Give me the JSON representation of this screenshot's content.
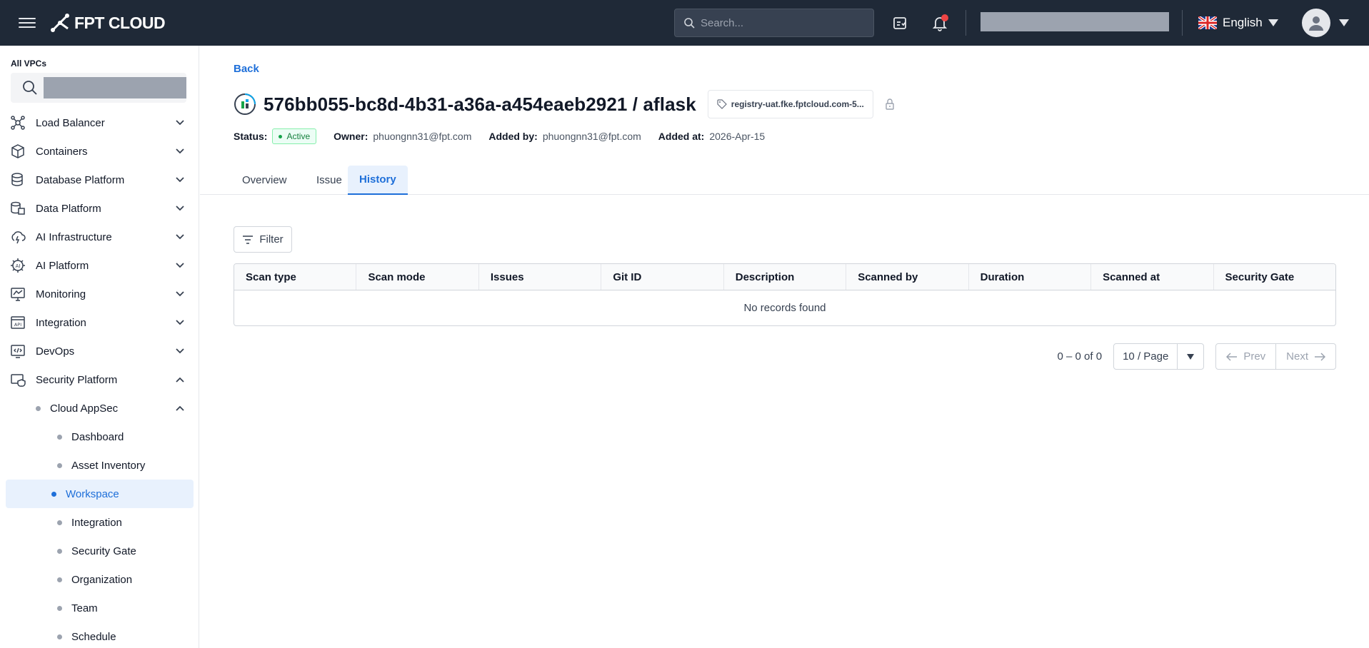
{
  "topbar": {
    "brand": "FPT CLOUD",
    "search_placeholder": "Search...",
    "language": "English"
  },
  "sidebar": {
    "vpc_label": "All VPCs",
    "items": [
      {
        "label": "Load Balancer",
        "icon": "load-balancer-icon",
        "expanded": false
      },
      {
        "label": "Containers",
        "icon": "containers-icon",
        "expanded": false
      },
      {
        "label": "Database Platform",
        "icon": "database-icon",
        "expanded": false
      },
      {
        "label": "Data Platform",
        "icon": "data-platform-icon",
        "expanded": false
      },
      {
        "label": "AI Infrastructure",
        "icon": "ai-infrastructure-icon",
        "expanded": false
      },
      {
        "label": "AI Platform",
        "icon": "ai-platform-icon",
        "expanded": false
      },
      {
        "label": "Monitoring",
        "icon": "monitoring-icon",
        "expanded": false
      },
      {
        "label": "Integration",
        "icon": "api-icon",
        "expanded": false
      },
      {
        "label": "DevOps",
        "icon": "devops-icon",
        "expanded": false
      },
      {
        "label": "Security Platform",
        "icon": "security-icon",
        "expanded": true
      }
    ],
    "security_sub": {
      "label": "Cloud AppSec",
      "children": [
        "Dashboard",
        "Asset Inventory",
        "Workspace",
        "Integration",
        "Security Gate",
        "Organization",
        "Team",
        "Schedule"
      ],
      "active": "Workspace"
    }
  },
  "main": {
    "back": "Back",
    "title": "576bb055-bc8d-4b31-a36a-a454eaeb2921 / aflask",
    "registry": "registry-uat.fke.fptcloud.com-5...",
    "status_label": "Status:",
    "status": "Active",
    "owner_label": "Owner:",
    "owner": "phuongnn31@fpt.com",
    "added_by_label": "Added by:",
    "added_by": "phuongnn31@fpt.com",
    "added_at_label": "Added at:",
    "added_at": "2026-Apr-15",
    "tabs": [
      "Overview",
      "Issue",
      "History"
    ],
    "active_tab": "History",
    "filter": "Filter",
    "columns": [
      "Scan type",
      "Scan mode",
      "Issues",
      "Git ID",
      "Description",
      "Scanned by",
      "Duration",
      "Scanned at",
      "Security Gate"
    ],
    "empty_text": "No records found",
    "pagination": {
      "range": "0 – 0 of 0",
      "page_size": "10 / Page",
      "prev": "Prev",
      "next": "Next"
    }
  },
  "colors": {
    "topbar_bg": "#1f2937",
    "accent": "#1e6fd9",
    "active_bg": "#e8f1fd",
    "success": "#16a34a",
    "notification": "#ef4444"
  }
}
